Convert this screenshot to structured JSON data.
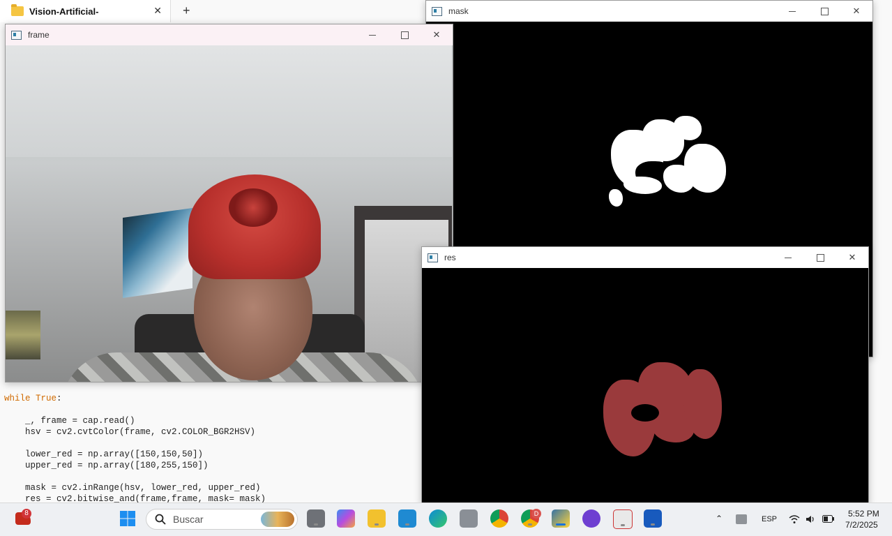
{
  "explorer": {
    "tab_title": "Vision-Artificial-",
    "close": "✕",
    "new_tab": "+"
  },
  "windows": {
    "frame": {
      "title": "frame"
    },
    "mask": {
      "title": "mask"
    },
    "res": {
      "title": "res"
    },
    "controls": {
      "minimize": "—",
      "maximize": "□",
      "close": "✕"
    }
  },
  "code": {
    "line1_kw": "while",
    "line1_kw2": "True",
    "line1_rest": ":",
    "line2": "    _, frame = cap.read()",
    "line3": "    hsv = cv2.cvtColor(frame, cv2.COLOR_BGR2HSV)",
    "line4": "    lower_red = np.array([150,150,50])",
    "line5": "    upper_red = np.array([180,255,150])",
    "line6": "    mask = cv2.inRange(hsv, lower_red, upper_red)",
    "line7": "    res = cv2.bitwise_and(frame,frame, mask= mask)"
  },
  "taskbar": {
    "notification_badge": "8",
    "search_placeholder": "Buscar",
    "chrome_profile_badge": "D",
    "language": "ESP",
    "time": "5:52 PM",
    "date": "7/2/2025"
  }
}
